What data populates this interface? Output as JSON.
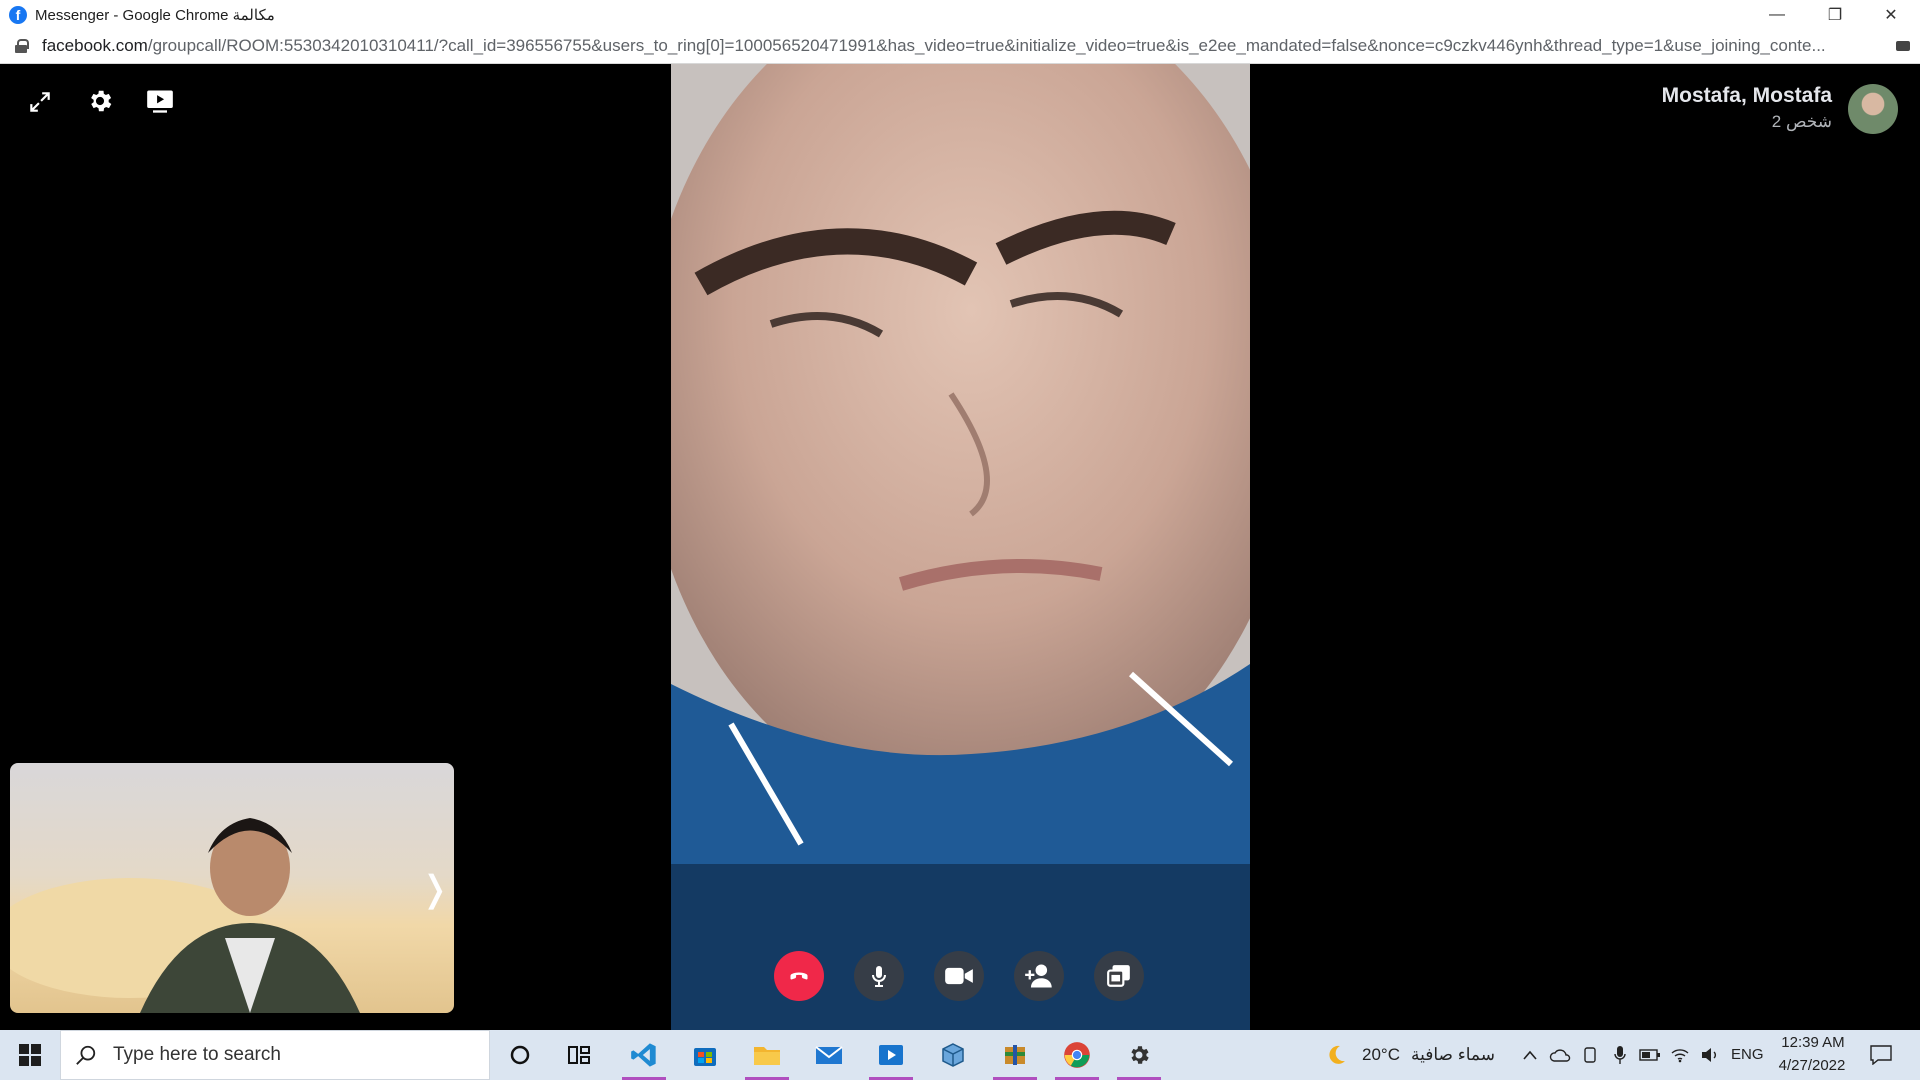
{
  "window": {
    "title": "Messenger - Google Chrome مكالمة",
    "minimize_glyph": "—",
    "maximize_glyph": "❐",
    "close_glyph": "✕"
  },
  "address": {
    "host": "facebook.com",
    "path": "/groupcall/ROOM:5530342010310411/?call_id=396556755&users_to_ring[0]=100056520471991&has_video=true&initialize_video=true&is_e2ee_mandated=false&nonce=c9czkv446ynh&thread_type=1&use_joining_conte..."
  },
  "call": {
    "participant_name": "Mostafa, Mostafa",
    "participant_count": "2 شخص",
    "icons": [
      "expand-icon",
      "settings-icon",
      "screen-share-icon"
    ],
    "controls": [
      "end-call",
      "microphone",
      "camera",
      "add-person",
      "share-screen"
    ],
    "self_view_chevron": "❭"
  },
  "taskbar": {
    "search_placeholder": "Type here to search",
    "weather_temp": "20°C",
    "weather_text": "سماء صافية",
    "language": "ENG",
    "time": "12:39 AM",
    "date": "4/27/2022"
  },
  "colors": {
    "end_call": "#f02849",
    "brand": "#1877f2",
    "taskbar": "#dbe5f1"
  }
}
